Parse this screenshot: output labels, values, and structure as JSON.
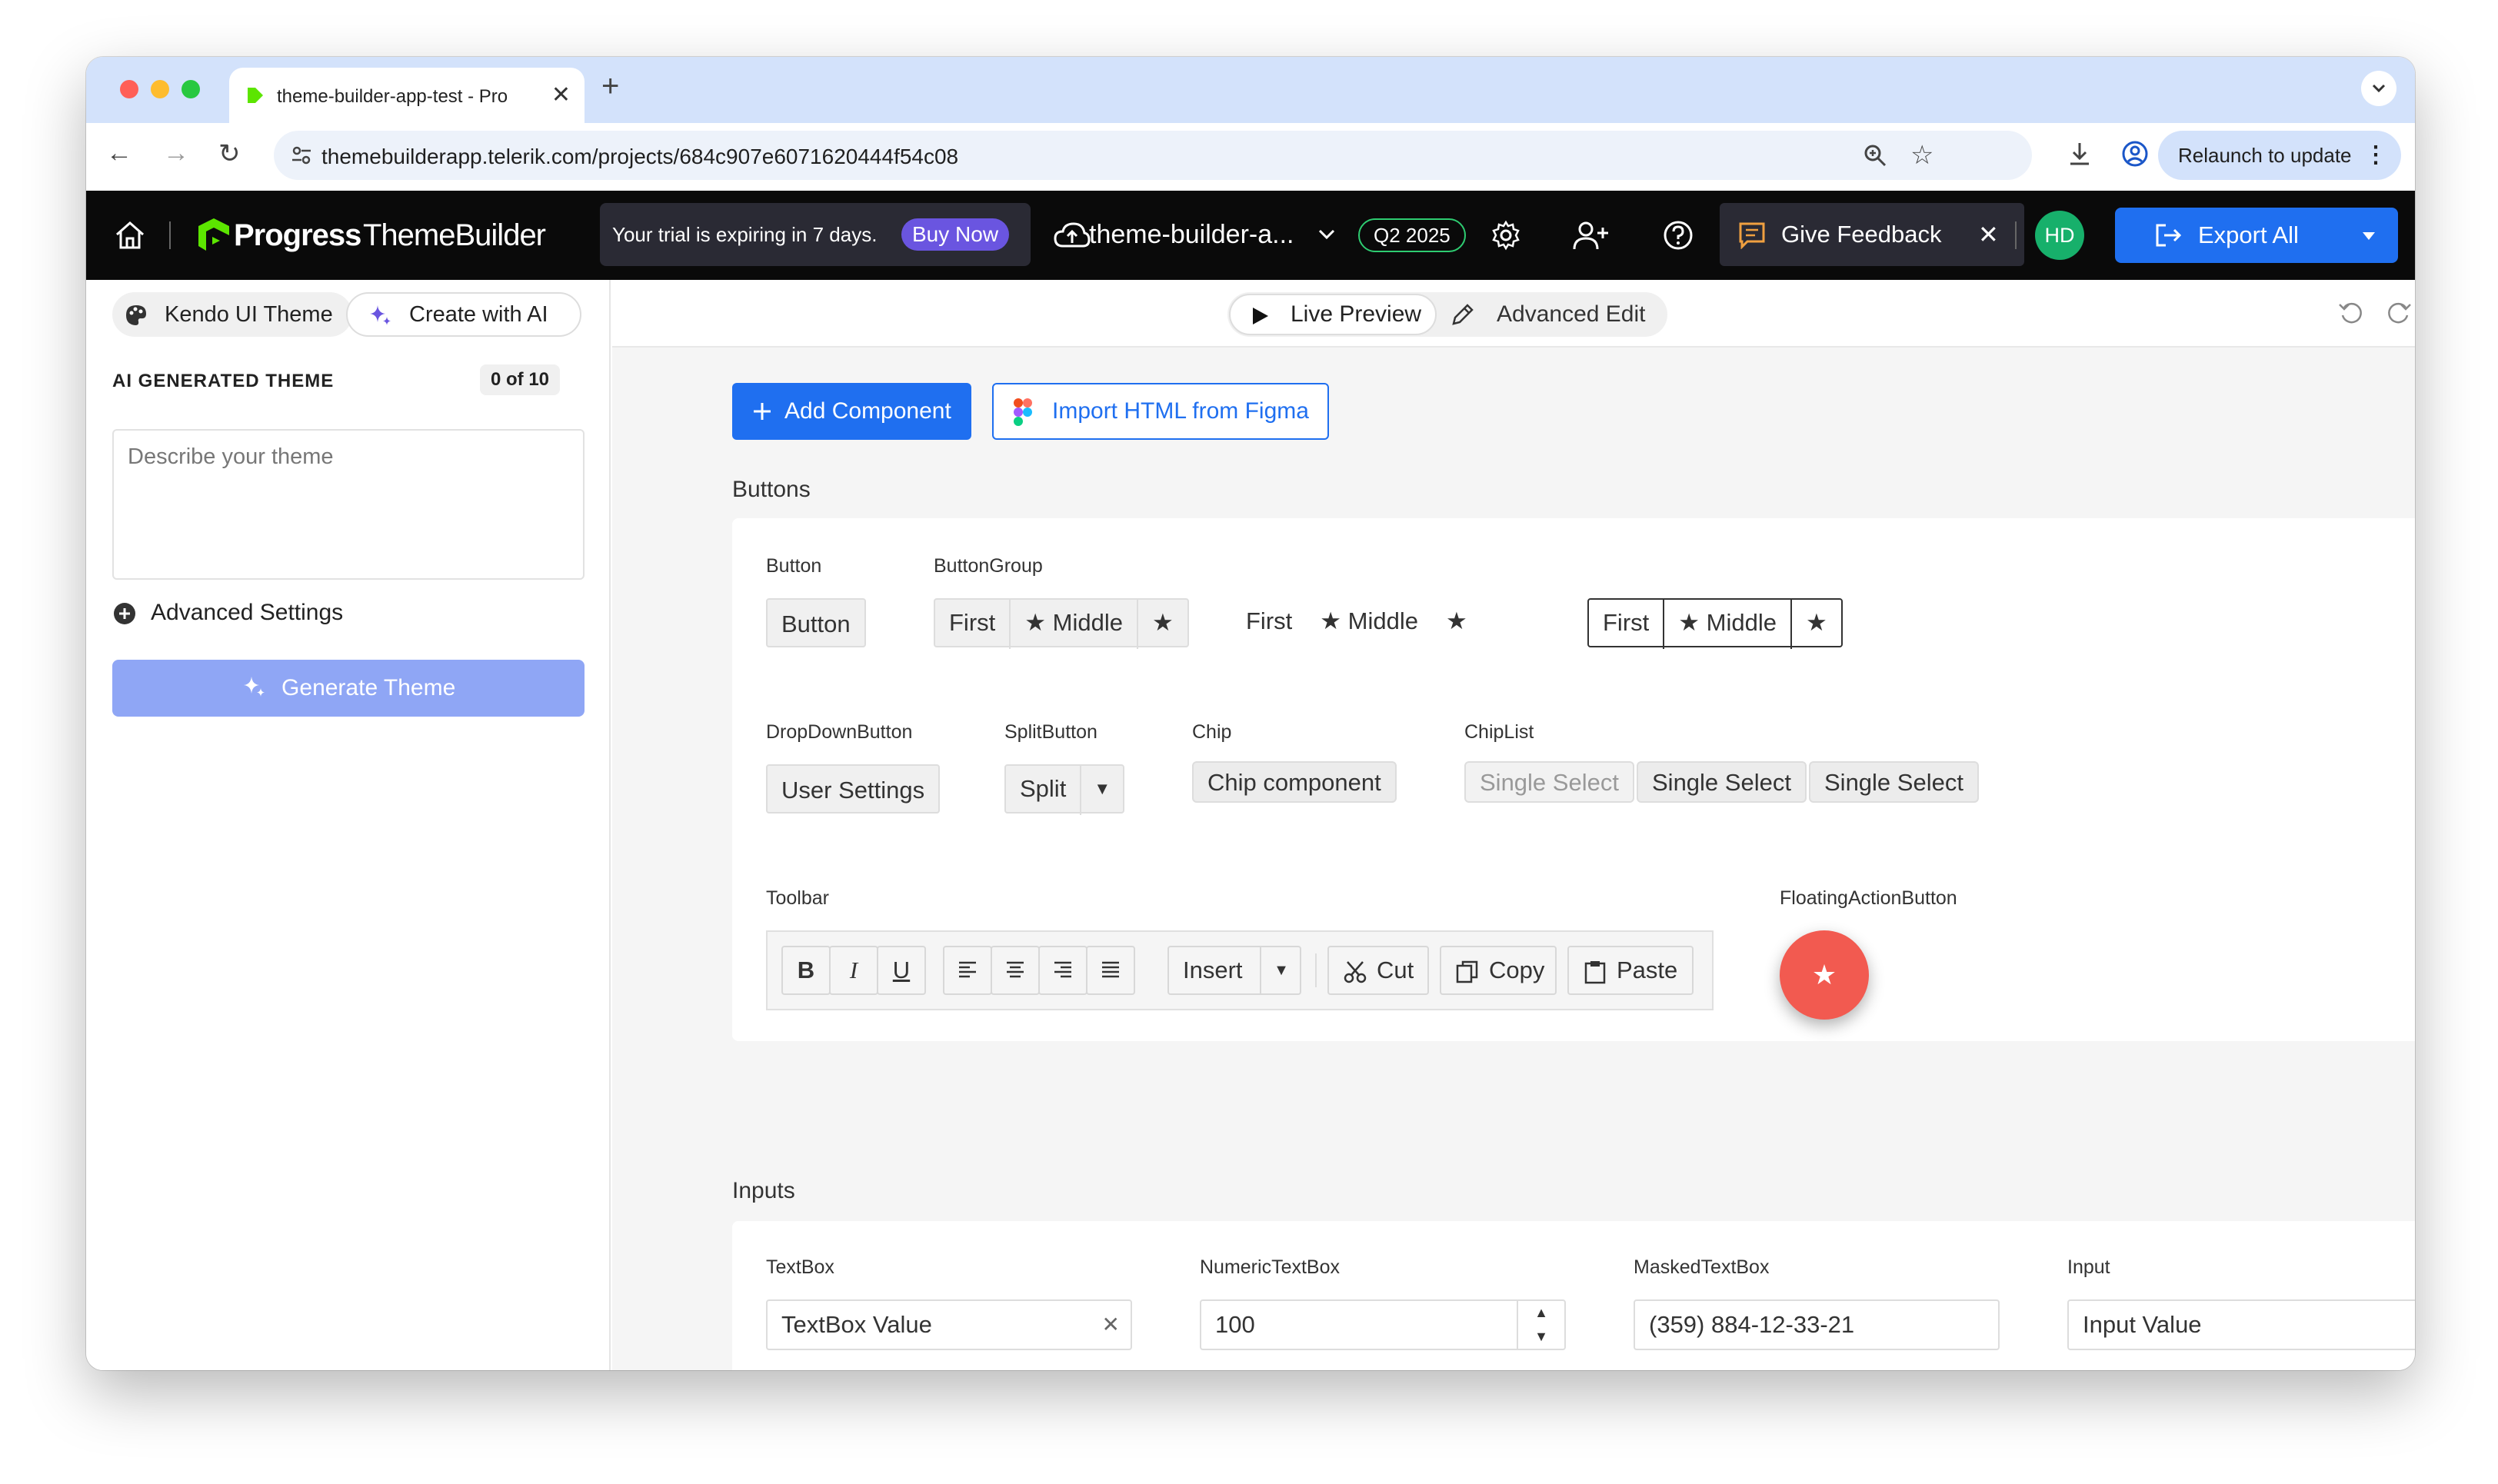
{
  "browser": {
    "tab_title": "theme-builder-app-test - Pro",
    "url": "themebuilderapp.telerik.com/projects/684c907e6071620444f54c08",
    "relaunch_label": "Relaunch to update"
  },
  "appbar": {
    "logo_brand": "Progress",
    "logo_product": "ThemeBuilder",
    "trial_text": "Your trial is expiring in 7 days.",
    "buy_now": "Buy Now",
    "project_name": "theme-builder-a...",
    "version_badge": "Q2 2025",
    "feedback_label": "Give Feedback",
    "avatar_initials": "HD",
    "export_label": "Export All"
  },
  "sidebar": {
    "tab_kendo": "Kendo UI Theme",
    "tab_ai": "Create with AI",
    "section_label": "AI GENERATED THEME",
    "count": "0 of 10",
    "textarea_placeholder": "Describe your theme",
    "advanced_settings": "Advanced Settings",
    "generate_button": "Generate Theme"
  },
  "content": {
    "live_preview": "Live Preview",
    "advanced_edit": "Advanced Edit",
    "add_component": "Add Component",
    "import_figma": "Import HTML from Figma",
    "buttons_section": "Buttons",
    "inputs_section": "Inputs"
  },
  "buttons_card": {
    "button_label": "Button",
    "button_text": "Button",
    "buttongroup_label": "ButtonGroup",
    "group_first": "First",
    "group_middle": "Middle",
    "dropdown_label": "DropDownButton",
    "dropdown_text": "User Settings",
    "split_label": "SplitButton",
    "split_text": "Split",
    "chip_label": "Chip",
    "chip_text": "Chip component",
    "chiplist_label": "ChipList",
    "chiplist_items": [
      "Single Select",
      "Single Select",
      "Single Select"
    ],
    "toolbar_label": "Toolbar",
    "toolbar_bold": "B",
    "toolbar_italic": "I",
    "toolbar_underline": "U",
    "toolbar_insert": "Insert",
    "toolbar_cut": "Cut",
    "toolbar_copy": "Copy",
    "toolbar_paste": "Paste",
    "fab_label": "FloatingActionButton"
  },
  "inputs_card": {
    "textbox_label": "TextBox",
    "textbox_value": "TextBox Value",
    "numeric_label": "NumericTextBox",
    "numeric_value": "100",
    "masked_label": "MaskedTextBox",
    "masked_value": "(359) 884-12-33-21",
    "input_label": "Input",
    "input_value": "Input Value"
  },
  "colors": {
    "accent_blue": "#1f6ff0",
    "ai_purple": "#6a55e0",
    "fab_red": "#f25a50",
    "avatar_green": "#17b06b",
    "version_green": "#2ecc71"
  },
  "icons": [
    "home-icon",
    "progress-logo-icon",
    "cloud-upload-icon",
    "gear-icon",
    "add-user-icon",
    "help-icon",
    "feedback-icon",
    "export-icon",
    "palette-icon",
    "sparkle-icon",
    "plus-circle-icon",
    "play-icon",
    "pencil-icon",
    "undo-icon",
    "redo-icon",
    "checklist-icon",
    "plus-icon",
    "figma-icon",
    "star-icon"
  ]
}
